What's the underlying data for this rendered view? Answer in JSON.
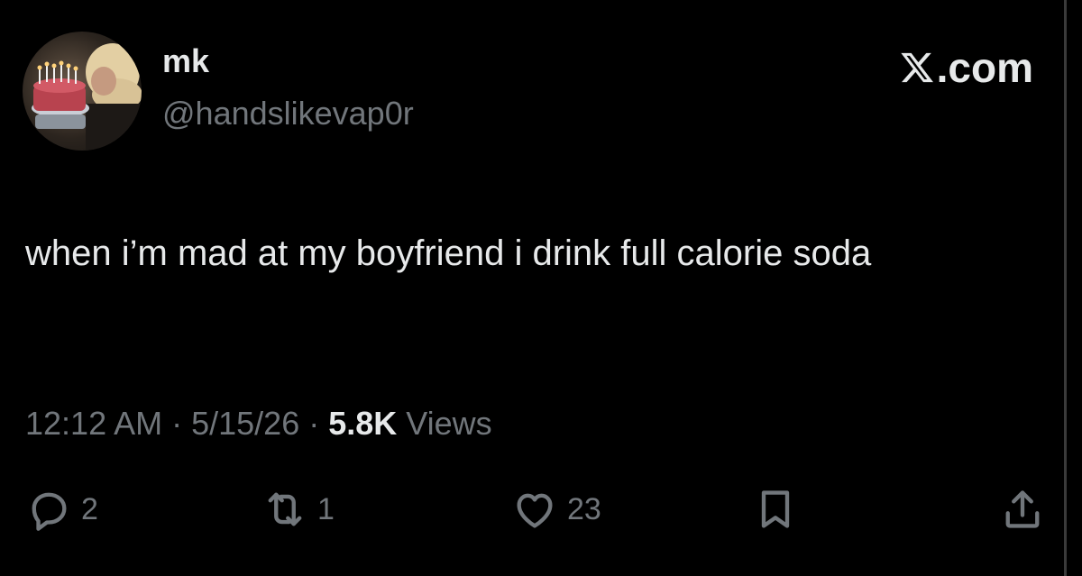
{
  "tweet": {
    "display_name": "mk",
    "handle": "@handslikevap0r",
    "site": ".com",
    "text": "when i’m mad at my boyfriend i drink full calorie soda",
    "time": "12:12 AM",
    "date": "5/15/26",
    "views_count": "5.8K",
    "views_label": "Views",
    "separator": " · "
  },
  "actions": {
    "replies": "2",
    "reposts": "1",
    "likes": "23"
  },
  "icons": {
    "avatar": "avatar-birthday-cake-photo",
    "site": "x-logo-icon",
    "reply": "reply-icon",
    "repost": "repost-icon",
    "like": "heart-icon",
    "bookmark": "bookmark-icon",
    "share": "share-icon"
  },
  "colors": {
    "background": "#000000",
    "primary_text": "#e7e9ea",
    "secondary_text": "#71767b"
  }
}
